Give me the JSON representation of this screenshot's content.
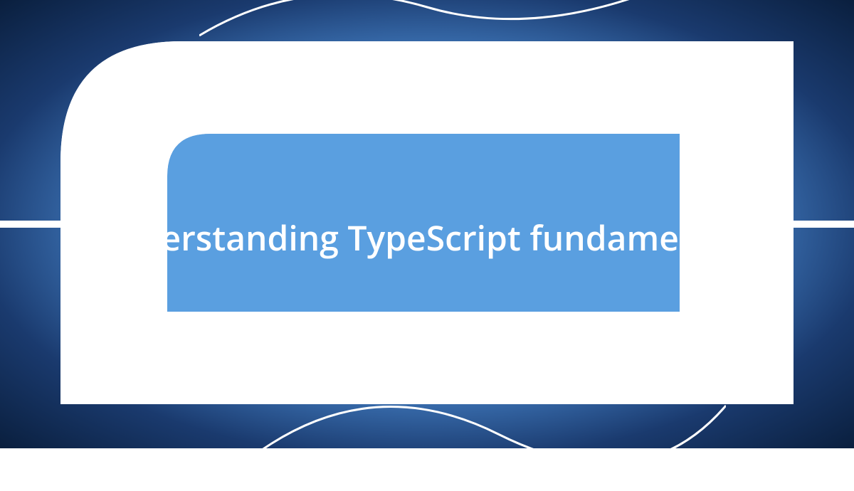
{
  "hero": {
    "title": "derstanding TypeScript fundament"
  },
  "colors": {
    "background_center": "#5a9fe0",
    "background_edge": "#0a1f3e",
    "shape_fill": "#ffffff",
    "inner_blue": "#5a9fe0"
  }
}
